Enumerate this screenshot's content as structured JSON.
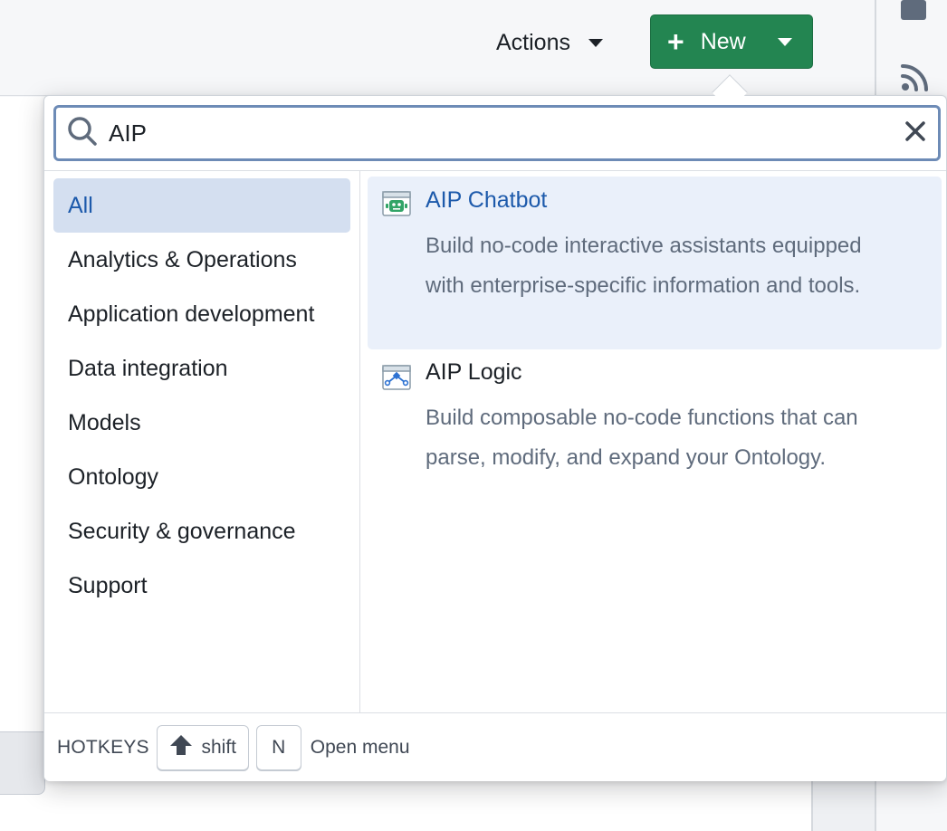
{
  "header": {
    "actions_label": "Actions",
    "new_label": "New",
    "new_plus": "+"
  },
  "search": {
    "value": "AIP",
    "placeholder": ""
  },
  "categories": [
    {
      "label": "All",
      "active": true
    },
    {
      "label": "Analytics & Operations"
    },
    {
      "label": "Application development"
    },
    {
      "label": "Data integration"
    },
    {
      "label": "Models"
    },
    {
      "label": "Ontology"
    },
    {
      "label": "Security & governance"
    },
    {
      "label": "Support"
    }
  ],
  "results": [
    {
      "title": "AIP Chatbot",
      "description": "Build no-code interactive assistants equipped with enterprise-specific information and tools.",
      "icon": "robot-icon",
      "active": true
    },
    {
      "title": "AIP Logic",
      "description": "Build composable no-code functions that can parse, modify, and expand your Ontology.",
      "icon": "logic-flow-icon"
    }
  ],
  "footer": {
    "hotkeys_label": "HOTKEYS",
    "shift_key": "shift",
    "n_key": "N",
    "open_menu_label": "Open menu"
  },
  "colors": {
    "primary_green": "#238551",
    "active_blue": "#1d5aab",
    "active_bg": "#d4dff0",
    "search_border": "#6d8bb6"
  }
}
